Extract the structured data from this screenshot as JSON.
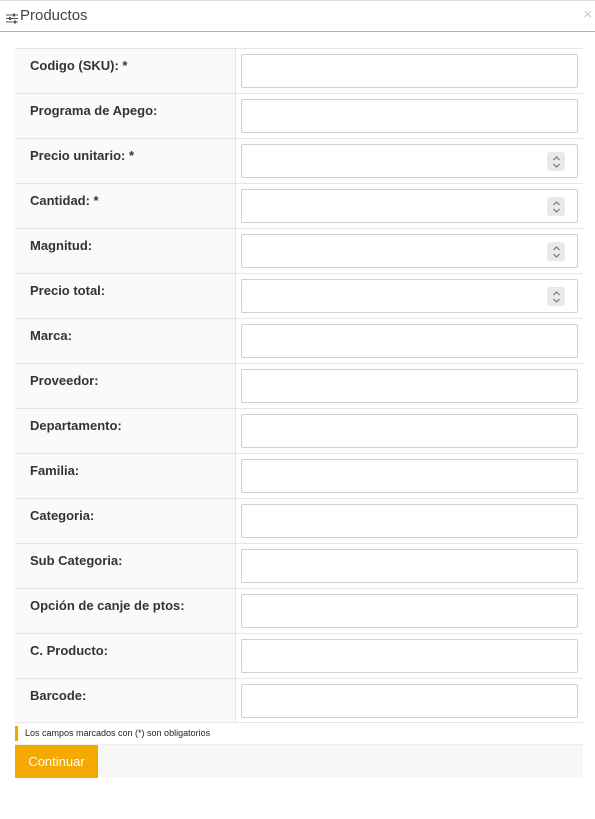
{
  "window": {
    "title": "Productos",
    "title_icon": "sliders-icon",
    "close_glyph": "×"
  },
  "form": {
    "fields": [
      {
        "label": "Codigo (SKU): *",
        "value": "",
        "type": "text"
      },
      {
        "label": "Programa de Apego:",
        "value": "",
        "type": "text"
      },
      {
        "label": "Precio unitario: *",
        "value": "",
        "type": "number"
      },
      {
        "label": "Cantidad: *",
        "value": "",
        "type": "number"
      },
      {
        "label": "Magnitud:",
        "value": "",
        "type": "number"
      },
      {
        "label": "Precio total:",
        "value": "",
        "type": "number"
      },
      {
        "label": "Marca:",
        "value": "",
        "type": "text"
      },
      {
        "label": "Proveedor:",
        "value": "",
        "type": "text"
      },
      {
        "label": "Departamento:",
        "value": "",
        "type": "text"
      },
      {
        "label": "Familia:",
        "value": "",
        "type": "text"
      },
      {
        "label": "Categoria:",
        "value": "",
        "type": "text"
      },
      {
        "label": "Sub Categoria:",
        "value": "",
        "type": "text"
      },
      {
        "label": "Opción de canje de ptos:",
        "value": "",
        "type": "text"
      },
      {
        "label": "C. Producto:",
        "value": "",
        "type": "text"
      },
      {
        "label": "Barcode:",
        "value": "",
        "type": "text"
      }
    ],
    "required_note": "Los campos marcados con (*) son obligatorios",
    "submit_label": "Continuar"
  },
  "colors": {
    "accent": "#f5a800",
    "note_bar": "#f0a500",
    "label_bg": "#fafafa",
    "border": "#e6e6e6"
  }
}
